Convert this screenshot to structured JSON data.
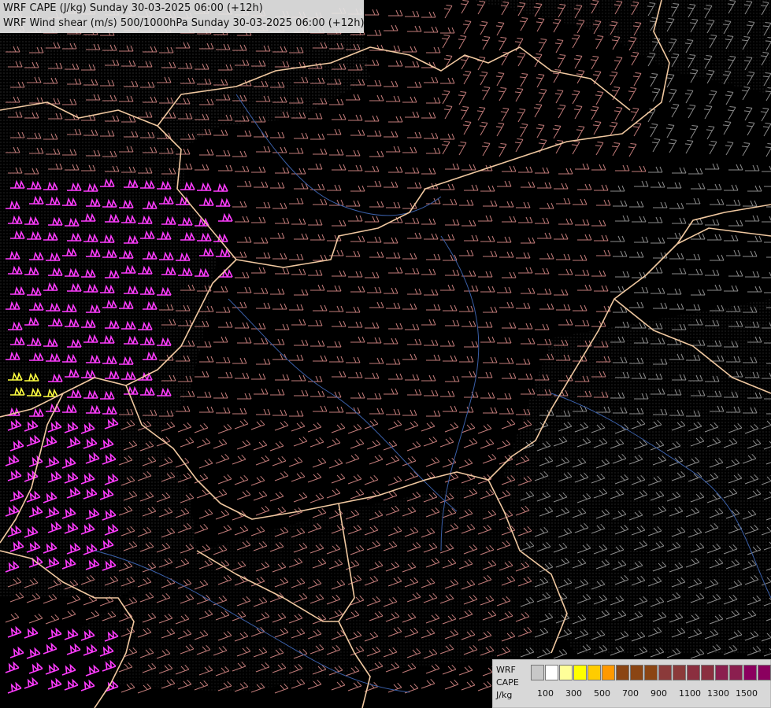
{
  "header": {
    "line1": "WRF CAPE (J/kg) Sunday 30-03-2025 06:00 (+12h)",
    "line2": "WRF Wind shear (m/s) 500/1000hPa Sunday 30-03-2025 06:00 (+12h)"
  },
  "legend": {
    "label_model": "WRF",
    "label_field": "CAPE",
    "label_unit": "J/kg",
    "swatch_colors": [
      "#c8c8c8",
      "#ffffff",
      "#ffff99",
      "#ffff00",
      "#ffcc00",
      "#ff9900",
      "#8b4513",
      "#8b4513",
      "#8b4513",
      "#8b3a3a",
      "#8b3a3a",
      "#8b2f3f",
      "#8b2f3f",
      "#8b1f4f",
      "#8b1f4f",
      "#8b005f",
      "#8b005f"
    ],
    "tick_labels": [
      "100",
      "300",
      "500",
      "700",
      "900",
      "1100",
      "1300",
      "1500"
    ]
  },
  "colors": {
    "background": "#000000",
    "border_line": "#f0c8a0",
    "river_line": "#3a5fa8",
    "barb_weak": "#8a8a8a",
    "barb_mid": "#c07a78",
    "barb_strong": "#ff3cff",
    "barb_max": "#ffff40"
  }
}
